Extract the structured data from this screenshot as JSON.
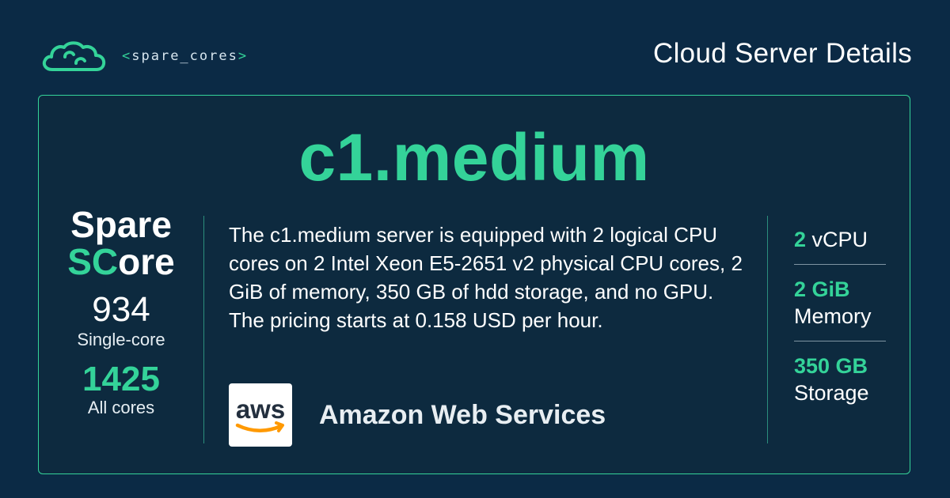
{
  "brand": {
    "logo_icon": "cloud-logo-icon",
    "name_open": "<",
    "name": "spare_cores",
    "name_close": ">"
  },
  "page_title": "Cloud Server Details",
  "server": {
    "name": "c1.medium",
    "description": "The c1.medium server is equipped with 2 logical CPU cores on 2 Intel Xeon E5-2651 v2 physical CPU cores, 2 GiB of memory, 350 GB of hdd storage, and no GPU. The pricing starts at 0.158 USD per hour."
  },
  "score": {
    "title_line1": "Spare",
    "title_sc": "SC",
    "title_rest": "ore",
    "single_core_value": "934",
    "single_core_label": "Single-core",
    "all_cores_value": "1425",
    "all_cores_label": "All cores"
  },
  "vendor": {
    "logo_icon": "aws-logo-icon",
    "logo_text": "aws",
    "name": "Amazon Web Services"
  },
  "specs": {
    "vcpu_value": "2",
    "vcpu_label": "vCPU",
    "memory_value": "2 GiB",
    "memory_label": "Memory",
    "storage_value": "350 GB",
    "storage_label": "Storage"
  },
  "colors": {
    "background": "#0b2a45",
    "card_background": "#0d2a3f",
    "accent": "#34d399",
    "aws_orange": "#ff9900",
    "aws_text": "#232f3e"
  }
}
